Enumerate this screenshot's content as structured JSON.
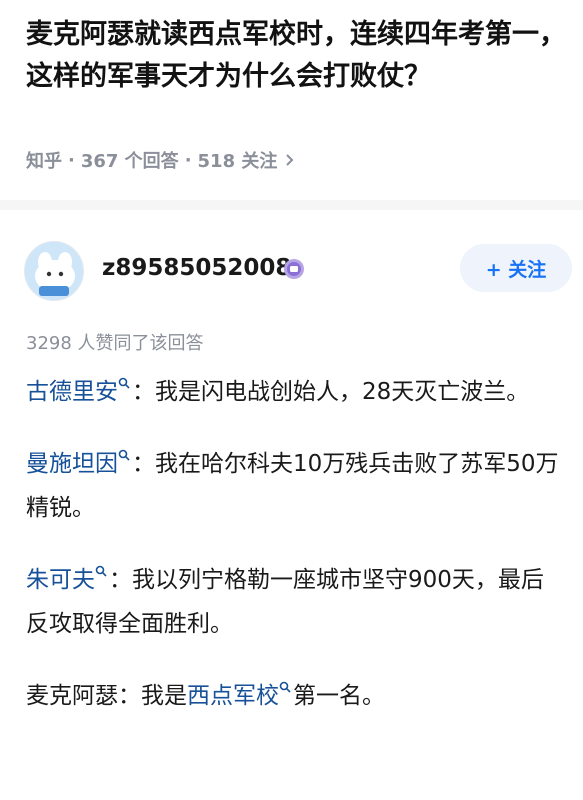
{
  "question": {
    "title": "麦克阿瑟就读西点军校时，连续四年考第一，这样的军事天才为什么会打败仗？",
    "source": "知乎",
    "answers_count": "367 个回答",
    "followers_count": "518 关注",
    "separator": "·"
  },
  "author": {
    "name": "z89585052008",
    "follow_label": "+ 关注"
  },
  "answer": {
    "votes_text": "3298 人赞同了该回答",
    "paragraphs": [
      {
        "link": "古德里安",
        "text": "：我是闪电战创始人，28天灭亡波兰。"
      },
      {
        "link": "曼施坦因",
        "text": "：我在哈尔科夫10万残兵击败了苏军50万精锐。"
      },
      {
        "link": "朱可夫",
        "text": "：我以列宁格勒一座城市坚守900天，最后反攻取得全面胜利。"
      },
      {
        "prefix": "麦克阿瑟：我是",
        "link": "西点军校",
        "text": "第一名。"
      }
    ]
  },
  "colors": {
    "link": "#175199",
    "accent": "#1772f6",
    "meta": "#8a8f99",
    "follow_bg": "#eef3fc"
  },
  "icons": [
    "chevron-right-icon",
    "verified-badge-icon",
    "plus-icon",
    "search-icon"
  ]
}
